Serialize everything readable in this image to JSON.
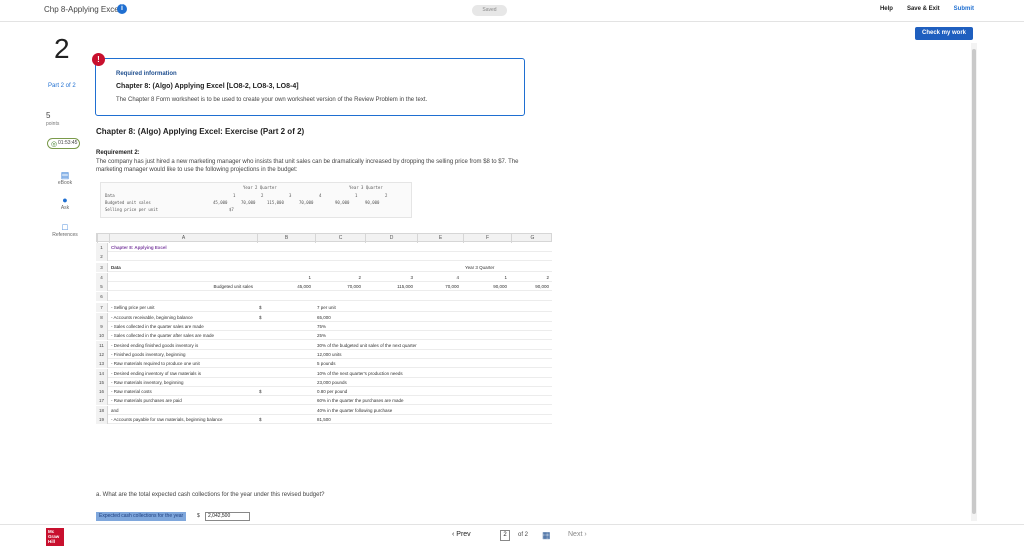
{
  "topbar": {
    "title": "Chp 8-Applying Excel",
    "saved": "Saved",
    "help": "Help",
    "save_exit": "Save & Exit",
    "submit": "Submit",
    "check": "Check my work"
  },
  "rail": {
    "question_number": "2",
    "part": "Part 2 of 2",
    "points_value": "5",
    "points_label": "points",
    "skipped": "01:53:45",
    "ebook": "eBook",
    "ask": "Ask",
    "references": "References"
  },
  "required_info": {
    "title": "Required information",
    "chapter": "Chapter 8: (Algo) Applying Excel [LO8-2, LO8-3, LO8-4]",
    "description": "The Chapter 8 Form worksheet is to be used to create your own worksheet version of the Review Problem in the text."
  },
  "exercise": {
    "title": "Chapter 8: (Algo) Applying Excel: Exercise (Part 2 of 2)",
    "req_label": "Requirement 2:",
    "req_text": "The company has just hired a new marketing manager who insists that unit sales can be dramatically increased by dropping the selling price from $8 to $7. The marketing manager would like to use the following projections in the budget:"
  },
  "mini_table": {
    "head1": "Year 2 Quarter",
    "head2": "Year 3 Quarter",
    "row_data": "Data",
    "row_units": "Budgeted unit sales",
    "row_price": "Selling price per unit",
    "q": [
      "1",
      "2",
      "3",
      "4",
      "1",
      "2"
    ],
    "units": [
      "45,000",
      "70,000",
      "115,000",
      "70,000",
      "90,000",
      "90,000"
    ],
    "price": "$7"
  },
  "sheet": {
    "columns": [
      "A",
      "B",
      "C",
      "D",
      "E",
      "F",
      "G"
    ],
    "rows": [
      {
        "n": "1",
        "a": "Chapter 8: Applying Excel",
        "b": "",
        "c": "",
        "d": "",
        "e": "",
        "f": "",
        "g": ""
      },
      {
        "n": "2",
        "a": "",
        "b": "",
        "c": "",
        "d": "",
        "e": "",
        "f": "",
        "g": ""
      },
      {
        "n": "3",
        "a": "Data",
        "b": "",
        "c": "",
        "d": "",
        "e": "",
        "f": "Year 3 Quarter",
        "g": ""
      },
      {
        "n": "4",
        "a": "",
        "b": "1",
        "c": "2",
        "d": "3",
        "e": "4",
        "f": "1",
        "g": "2"
      },
      {
        "n": "5",
        "a": "Budgeted unit sales",
        "b": "45,000",
        "c": "70,000",
        "d": "115,000",
        "e": "70,000",
        "f": "90,000",
        "g": "90,000"
      },
      {
        "n": "6",
        "a": "",
        "b": "",
        "c": "",
        "d": "",
        "e": "",
        "f": "",
        "g": ""
      },
      {
        "n": "7",
        "a": "- Selling price per unit",
        "b": "$",
        "c": "7 per unit",
        "d": "",
        "e": "",
        "f": "",
        "g": ""
      },
      {
        "n": "8",
        "a": "- Accounts receivable, beginning balance",
        "b": "$",
        "c": "65,000",
        "d": "",
        "e": "",
        "f": "",
        "g": ""
      },
      {
        "n": "9",
        "a": "- Sales collected in the quarter sales are made",
        "b": "",
        "c": "75%",
        "d": "",
        "e": "",
        "f": "",
        "g": ""
      },
      {
        "n": "10",
        "a": "- Sales collected in the quarter after sales are made",
        "b": "",
        "c": "25%",
        "d": "",
        "e": "",
        "f": "",
        "g": ""
      },
      {
        "n": "11",
        "a": "- Desired ending finished goods inventory is",
        "b": "",
        "c": "30% of the budgeted unit sales of the next quarter",
        "d": "",
        "e": "",
        "f": "",
        "g": ""
      },
      {
        "n": "12",
        "a": "- Finished goods inventory, beginning",
        "b": "",
        "c": "12,000 units",
        "d": "",
        "e": "",
        "f": "",
        "g": ""
      },
      {
        "n": "13",
        "a": "- Raw materials required to produce one unit",
        "b": "",
        "c": "5 pounds",
        "d": "",
        "e": "",
        "f": "",
        "g": ""
      },
      {
        "n": "14",
        "a": "- Desired ending inventory of raw materials is",
        "b": "",
        "c": "10% of the next quarter's production needs",
        "d": "",
        "e": "",
        "f": "",
        "g": ""
      },
      {
        "n": "15",
        "a": "- Raw materials inventory, beginning",
        "b": "",
        "c": "23,000 pounds",
        "d": "",
        "e": "",
        "f": "",
        "g": ""
      },
      {
        "n": "16",
        "a": "- Raw material costs",
        "b": "$",
        "c": "0.80 per pound",
        "d": "",
        "e": "",
        "f": "",
        "g": ""
      },
      {
        "n": "17",
        "a": "- Raw materials purchases are paid",
        "b": "",
        "c": "60% in the quarter the purchases are made",
        "d": "",
        "e": "",
        "f": "",
        "g": ""
      },
      {
        "n": "18",
        "a": "and",
        "b": "",
        "c": "40% in the quarter following purchase",
        "d": "",
        "e": "",
        "f": "",
        "g": ""
      },
      {
        "n": "19",
        "a": "- Accounts payable for raw materials, beginning balance",
        "b": "$",
        "c": "81,500",
        "d": "",
        "e": "",
        "f": "",
        "g": ""
      }
    ]
  },
  "question": {
    "text": "a. What are the total expected cash collections for the year under this revised budget?",
    "answer_label": "Expected cash collections for the year",
    "answer_dollar": "$",
    "answer_value": "2,042,500"
  },
  "nav": {
    "logo": "Mc Graw Hill",
    "prev": "Prev",
    "page": "2",
    "of": "of 2",
    "next": "Next"
  }
}
